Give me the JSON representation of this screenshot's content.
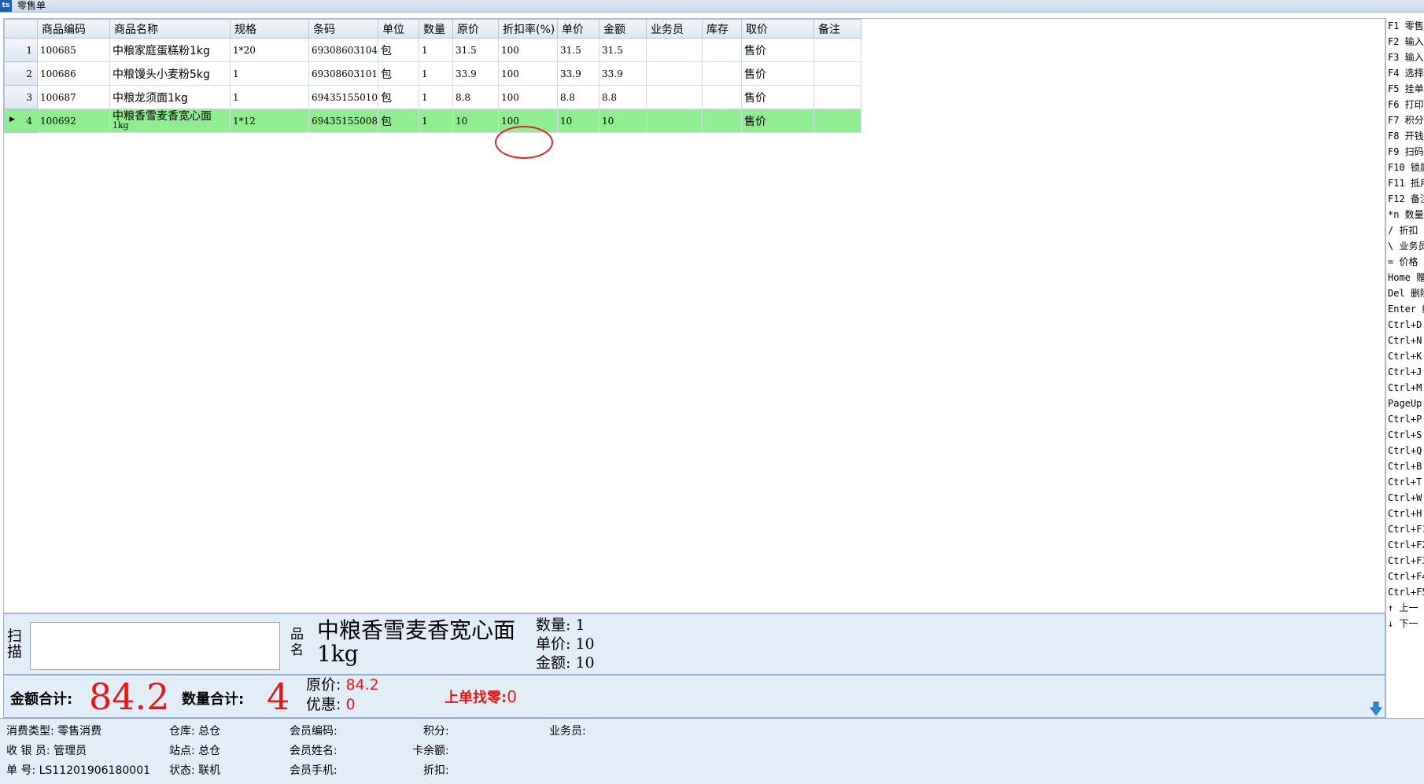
{
  "window": {
    "title": "零售单",
    "icon_text": "ts"
  },
  "grid": {
    "columns": [
      "",
      "商品编码",
      "商品名称",
      "规格",
      "条码",
      "单位",
      "数量",
      "原价",
      "折扣率(%)",
      "单价",
      "金额",
      "业务员",
      "库存",
      "取价",
      "备注"
    ],
    "rows": [
      {
        "idx": "1",
        "code": "100685",
        "name": "中粮家庭蛋糕粉1kg",
        "spec": "1*20",
        "barcode": "69308603104",
        "unit": "包",
        "qty": "1",
        "orig_price": "31.5",
        "discount": "100",
        "price": "31.5",
        "amount": "31.5",
        "salesman": "",
        "stock": "",
        "pricing": "售价",
        "note": ""
      },
      {
        "idx": "2",
        "code": "100686",
        "name": "中粮馒头小麦粉5kg",
        "spec": "1",
        "barcode": "69308603101",
        "unit": "包",
        "qty": "1",
        "orig_price": "33.9",
        "discount": "100",
        "price": "33.9",
        "amount": "33.9",
        "salesman": "",
        "stock": "",
        "pricing": "售价",
        "note": ""
      },
      {
        "idx": "3",
        "code": "100687",
        "name": "中粮龙须面1kg",
        "spec": "1",
        "barcode": "69435155010",
        "unit": "包",
        "qty": "1",
        "orig_price": "8.8",
        "discount": "100",
        "price": "8.8",
        "amount": "8.8",
        "salesman": "",
        "stock": "",
        "pricing": "售价",
        "note": ""
      },
      {
        "idx": "4",
        "code": "100692",
        "name": "中粮香雪麦香宽心面",
        "name_line2": "1kg",
        "spec": "1*12",
        "barcode": "69435155008",
        "unit": "包",
        "qty": "1",
        "orig_price": "10",
        "discount": "100",
        "price": "10",
        "amount": "10",
        "salesman": "",
        "stock": "",
        "pricing": "售价",
        "note": ""
      }
    ],
    "selected_row_color": "#90ee90",
    "highlight_color": "#d9262a"
  },
  "shortcuts": [
    "F1 零售",
    "F2 输入",
    "F3 输入",
    "F4 选择",
    "F5 挂单",
    "F6 打印",
    "F7 积分",
    "F8 开钱",
    "F9 扫码",
    "F10 锁屏",
    "F11 抵用",
    "F12 备注",
    "*n 数量",
    "/ 折扣",
    "\\ 业务员",
    "= 价格",
    "Home 赠",
    "Del 删除",
    "Enter 结",
    "Ctrl+D",
    "Ctrl+N",
    "Ctrl+K",
    "Ctrl+J",
    "Ctrl+M",
    "PageUp",
    "Ctrl+P",
    "Ctrl+S",
    "Ctrl+Q",
    "Ctrl+B",
    "Ctrl+T",
    "Ctrl+W",
    "Ctrl+H",
    "Ctrl+F1",
    "Ctrl+F2",
    "Ctrl+F3",
    "Ctrl+F4",
    "Ctrl+F5",
    "↑ 上一",
    "↓ 下一"
  ],
  "scan": {
    "label_line1": "扫",
    "label_line2": "描",
    "input_value": "",
    "pin_label_line1": "品",
    "pin_label_line2": "名",
    "product_name_line1": "中粮香雪麦香宽心面",
    "product_name_line2": "1kg",
    "qty_label": "数量:",
    "qty_value": "1",
    "price_label": "单价:",
    "price_value": "10",
    "amount_label": "金额:",
    "amount_value": "10"
  },
  "totals": {
    "amount_label": "金额合计:",
    "amount_value": "84.2",
    "qty_label": "数量合计:",
    "qty_value": "4",
    "orig_label": "原价:",
    "orig_value": "84.2",
    "discount_label": "优惠:",
    "discount_value": "0",
    "change_label": "上单找零:",
    "change_value": "0",
    "accent_color": "#e01919",
    "arrow_icon": "down-arrow-icon"
  },
  "info": {
    "consume_type": "消费类型: 零售消费",
    "cashier": "收 银 员: 管理员",
    "order_no": "单      号: LS11201906180001",
    "warehouse": "仓库: 总仓",
    "site": "站点: 总仓",
    "status": "状态: 联机",
    "member_code": "会员编码:",
    "member_name": "会员姓名:",
    "member_phone": "会员手机:",
    "points": "积分:",
    "card_balance": "卡余额:",
    "discount": "折扣:",
    "salesman": "业务员:"
  }
}
